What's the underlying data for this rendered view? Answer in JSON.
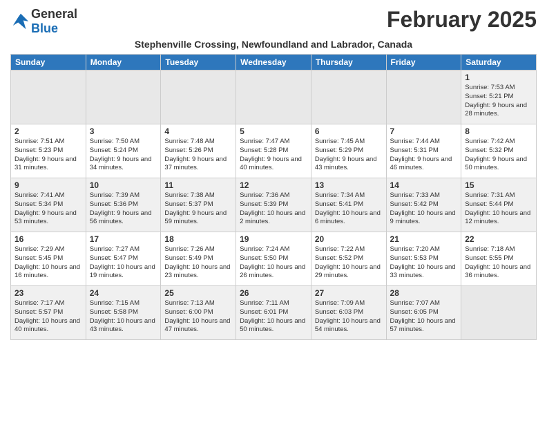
{
  "header": {
    "logo_general": "General",
    "logo_blue": "Blue",
    "month_title": "February 2025",
    "location": "Stephenville Crossing, Newfoundland and Labrador, Canada"
  },
  "days_of_week": [
    "Sunday",
    "Monday",
    "Tuesday",
    "Wednesday",
    "Thursday",
    "Friday",
    "Saturday"
  ],
  "weeks": [
    [
      {
        "day": "",
        "info": ""
      },
      {
        "day": "",
        "info": ""
      },
      {
        "day": "",
        "info": ""
      },
      {
        "day": "",
        "info": ""
      },
      {
        "day": "",
        "info": ""
      },
      {
        "day": "",
        "info": ""
      },
      {
        "day": "1",
        "info": "Sunrise: 7:53 AM\nSunset: 5:21 PM\nDaylight: 9 hours and 28 minutes."
      }
    ],
    [
      {
        "day": "2",
        "info": "Sunrise: 7:51 AM\nSunset: 5:23 PM\nDaylight: 9 hours and 31 minutes."
      },
      {
        "day": "3",
        "info": "Sunrise: 7:50 AM\nSunset: 5:24 PM\nDaylight: 9 hours and 34 minutes."
      },
      {
        "day": "4",
        "info": "Sunrise: 7:48 AM\nSunset: 5:26 PM\nDaylight: 9 hours and 37 minutes."
      },
      {
        "day": "5",
        "info": "Sunrise: 7:47 AM\nSunset: 5:28 PM\nDaylight: 9 hours and 40 minutes."
      },
      {
        "day": "6",
        "info": "Sunrise: 7:45 AM\nSunset: 5:29 PM\nDaylight: 9 hours and 43 minutes."
      },
      {
        "day": "7",
        "info": "Sunrise: 7:44 AM\nSunset: 5:31 PM\nDaylight: 9 hours and 46 minutes."
      },
      {
        "day": "8",
        "info": "Sunrise: 7:42 AM\nSunset: 5:32 PM\nDaylight: 9 hours and 50 minutes."
      }
    ],
    [
      {
        "day": "9",
        "info": "Sunrise: 7:41 AM\nSunset: 5:34 PM\nDaylight: 9 hours and 53 minutes."
      },
      {
        "day": "10",
        "info": "Sunrise: 7:39 AM\nSunset: 5:36 PM\nDaylight: 9 hours and 56 minutes."
      },
      {
        "day": "11",
        "info": "Sunrise: 7:38 AM\nSunset: 5:37 PM\nDaylight: 9 hours and 59 minutes."
      },
      {
        "day": "12",
        "info": "Sunrise: 7:36 AM\nSunset: 5:39 PM\nDaylight: 10 hours and 2 minutes."
      },
      {
        "day": "13",
        "info": "Sunrise: 7:34 AM\nSunset: 5:41 PM\nDaylight: 10 hours and 6 minutes."
      },
      {
        "day": "14",
        "info": "Sunrise: 7:33 AM\nSunset: 5:42 PM\nDaylight: 10 hours and 9 minutes."
      },
      {
        "day": "15",
        "info": "Sunrise: 7:31 AM\nSunset: 5:44 PM\nDaylight: 10 hours and 12 minutes."
      }
    ],
    [
      {
        "day": "16",
        "info": "Sunrise: 7:29 AM\nSunset: 5:45 PM\nDaylight: 10 hours and 16 minutes."
      },
      {
        "day": "17",
        "info": "Sunrise: 7:27 AM\nSunset: 5:47 PM\nDaylight: 10 hours and 19 minutes."
      },
      {
        "day": "18",
        "info": "Sunrise: 7:26 AM\nSunset: 5:49 PM\nDaylight: 10 hours and 23 minutes."
      },
      {
        "day": "19",
        "info": "Sunrise: 7:24 AM\nSunset: 5:50 PM\nDaylight: 10 hours and 26 minutes."
      },
      {
        "day": "20",
        "info": "Sunrise: 7:22 AM\nSunset: 5:52 PM\nDaylight: 10 hours and 29 minutes."
      },
      {
        "day": "21",
        "info": "Sunrise: 7:20 AM\nSunset: 5:53 PM\nDaylight: 10 hours and 33 minutes."
      },
      {
        "day": "22",
        "info": "Sunrise: 7:18 AM\nSunset: 5:55 PM\nDaylight: 10 hours and 36 minutes."
      }
    ],
    [
      {
        "day": "23",
        "info": "Sunrise: 7:17 AM\nSunset: 5:57 PM\nDaylight: 10 hours and 40 minutes."
      },
      {
        "day": "24",
        "info": "Sunrise: 7:15 AM\nSunset: 5:58 PM\nDaylight: 10 hours and 43 minutes."
      },
      {
        "day": "25",
        "info": "Sunrise: 7:13 AM\nSunset: 6:00 PM\nDaylight: 10 hours and 47 minutes."
      },
      {
        "day": "26",
        "info": "Sunrise: 7:11 AM\nSunset: 6:01 PM\nDaylight: 10 hours and 50 minutes."
      },
      {
        "day": "27",
        "info": "Sunrise: 7:09 AM\nSunset: 6:03 PM\nDaylight: 10 hours and 54 minutes."
      },
      {
        "day": "28",
        "info": "Sunrise: 7:07 AM\nSunset: 6:05 PM\nDaylight: 10 hours and 57 minutes."
      },
      {
        "day": "",
        "info": ""
      }
    ]
  ]
}
